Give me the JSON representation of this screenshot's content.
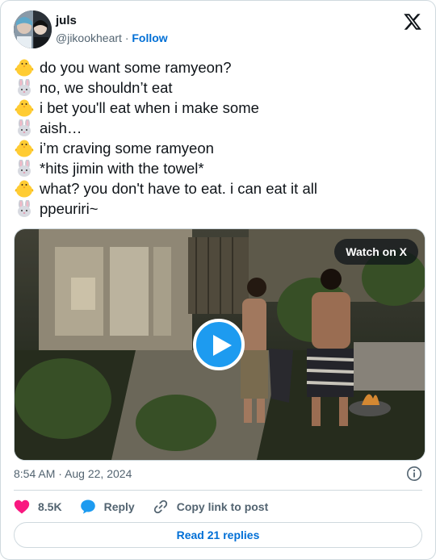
{
  "author": {
    "display_name": "juls",
    "handle": "@jikookheart",
    "separator": "·",
    "follow_label": "Follow"
  },
  "tweet_lines": [
    {
      "icon": "chick-emoji-icon",
      "text": "do you want some ramyeon?"
    },
    {
      "icon": "rabbit-emoji-icon",
      "text": "no, we shouldn’t eat"
    },
    {
      "icon": "chick-emoji-icon",
      "text": "i bet you'll eat when i make some"
    },
    {
      "icon": "rabbit-emoji-icon",
      "text": "aish…"
    },
    {
      "icon": "chick-emoji-icon",
      "text": "i’m craving some ramyeon"
    },
    {
      "icon": "rabbit-emoji-icon",
      "text": "*hits jimin with the towel*"
    },
    {
      "icon": "chick-emoji-icon",
      "text": "what? you don't have to eat. i can eat it all"
    },
    {
      "icon": "rabbit-emoji-icon",
      "text": "ppeuriri~"
    }
  ],
  "media": {
    "watch_label": "Watch on X"
  },
  "meta": {
    "time": "8:54 AM",
    "separator": "·",
    "date": "Aug 22, 2024"
  },
  "actions": {
    "likes": "8.5K",
    "reply_label": "Reply",
    "copy_label": "Copy link to post"
  },
  "read_replies_label": "Read 21 replies",
  "colors": {
    "text": "#0f1419",
    "secondary": "#536471",
    "link": "#006fd6",
    "play": "#1d9bf0",
    "heart": "#f91880",
    "border": "#cfd9de"
  }
}
